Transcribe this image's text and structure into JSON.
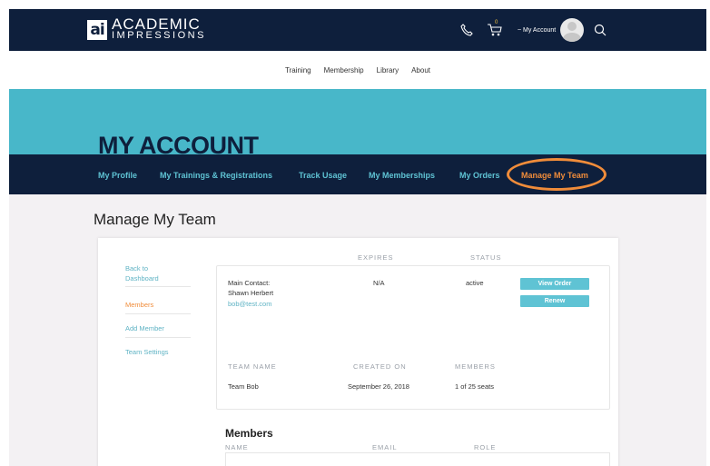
{
  "brand": {
    "mark": "ai",
    "line1": "ACADEMIC",
    "line2": "IMPRESSIONS"
  },
  "top_icons": {
    "phone": "phone-icon",
    "cart": "cart-icon",
    "cart_count": "0",
    "account_label": "~ My Account",
    "search": "search-icon"
  },
  "nav": [
    "Training",
    "Membership",
    "Library",
    "About"
  ],
  "hero": {
    "title": "MY ACCOUNT"
  },
  "subnav": [
    "My Profile",
    "My Trainings & Registrations",
    "Track Usage",
    "My Memberships",
    "My Orders",
    "Manage My Team"
  ],
  "page": {
    "title": "Manage My Team"
  },
  "sidebar": [
    "Back to Dashboard",
    "Members",
    "Add Member",
    "Team Settings"
  ],
  "subscription": {
    "headers": [
      "EXPIRES",
      "STATUS"
    ],
    "contact_label": "Main Contact:",
    "contact_name": "Shawn Herbert",
    "contact_email": "bob@test.com",
    "expires": "N/A",
    "status": "active",
    "view_order": "View Order",
    "renew": "Renew"
  },
  "team": {
    "headers": [
      "TEAM NAME",
      "CREATED ON",
      "MEMBERS"
    ],
    "name": "Team Bob",
    "created": "September 26, 2018",
    "members": "1 of 25 seats"
  },
  "members": {
    "heading": "Members",
    "headers": [
      "NAME",
      "EMAIL",
      "ROLE"
    ]
  },
  "colors": {
    "navy": "#0e1f3c",
    "teal": "#48b7c9",
    "accent": "#f08c3a",
    "link": "#5fb3c4"
  }
}
